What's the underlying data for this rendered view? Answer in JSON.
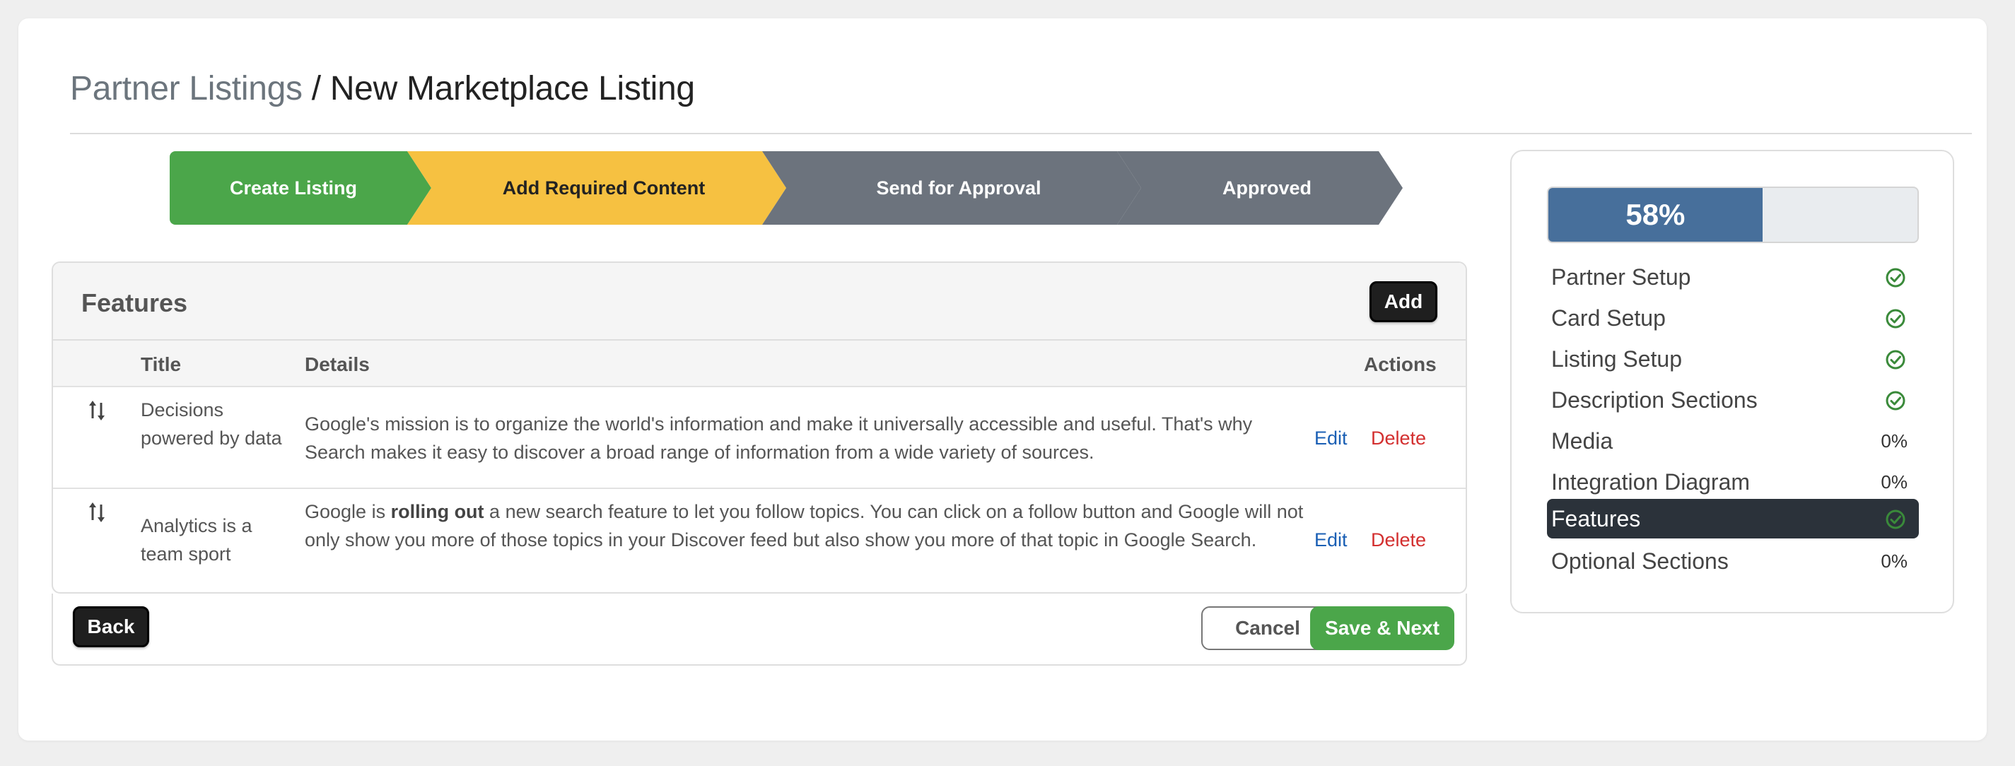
{
  "breadcrumb": {
    "parent": "Partner Listings",
    "separator": " / ",
    "current": "New Marketplace Listing"
  },
  "stepper": [
    {
      "label": "Create Listing",
      "color": "#4ba64a",
      "text_color": "#ffffff"
    },
    {
      "label": "Add Required Content",
      "color": "#f6c141",
      "text_color": "#222222"
    },
    {
      "label": "Send for Approval",
      "color": "#6c737d",
      "text_color": "#ffffff"
    },
    {
      "label": "Approved",
      "color": "#6c737d",
      "text_color": "#ffffff"
    }
  ],
  "features": {
    "title": "Features",
    "add_label": "Add",
    "columns": {
      "title": "Title",
      "details": "Details",
      "actions": "Actions"
    },
    "rows": [
      {
        "title": "Decisions powered by data",
        "details": "Google's mission is to organize the world's information and make it universally accessible and useful. That's why Search makes it easy to discover a broad range of information from a wide variety of sources.",
        "edit": "Edit",
        "delete": "Delete"
      },
      {
        "title": "Analytics is a team sport",
        "details_pre": "Google is ",
        "details_bold": "rolling out",
        "details_post": " a new search feature to let you follow topics. You can click on a follow button and Google will not only show you more of those topics in your Discover feed but also show you more of that topic in Google Search.",
        "edit": "Edit",
        "delete": "Delete"
      }
    ]
  },
  "footer": {
    "back": "Back",
    "cancel": "Cancel",
    "save_next": "Save & Next"
  },
  "progress": {
    "label": "58%",
    "value": 0.58,
    "items": [
      {
        "name": "Partner Setup",
        "status": "check-circle-icon"
      },
      {
        "name": "Card Setup",
        "status": "check-circle-icon"
      },
      {
        "name": "Listing Setup",
        "status": "check-circle-icon"
      },
      {
        "name": "Description Sections",
        "status": "check-circle-icon"
      },
      {
        "name": "Media",
        "pct": "0%"
      },
      {
        "name": "Integration Diagram",
        "pct": "0%"
      },
      {
        "name": "Features",
        "status": "check-circle-icon",
        "active": true
      },
      {
        "name": "Optional Sections",
        "pct": "0%"
      }
    ]
  },
  "colors": {
    "check": "#3a8a3a",
    "link": "#1a5fb4",
    "danger": "#d32f2f",
    "progress": "#476f9b",
    "active": "#2b323a"
  }
}
